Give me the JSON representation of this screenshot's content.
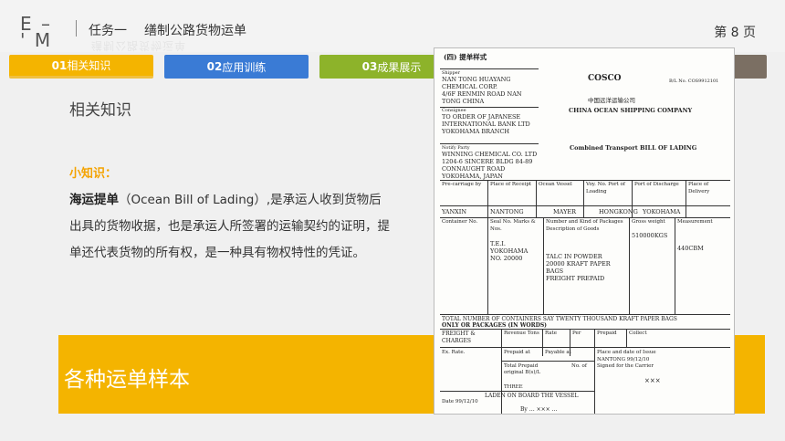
{
  "header": {
    "logo": "E – ' M",
    "task_label": "任务一",
    "task_title": "缮制公路货物运单",
    "task_shadow": "缮制公路货物运单",
    "page": "第 8 页"
  },
  "tabs": [
    {
      "num": "01",
      "label": "相关知识"
    },
    {
      "num": "02",
      "label": "应用训练"
    },
    {
      "num": "03",
      "label": "成果展示"
    }
  ],
  "content": {
    "section_title": "相关知识",
    "tip_label": "小知识：",
    "term": "海运提单",
    "body": "（Ocean Bill of Lading）,是承运人收到货物后出具的货物收据，也是承运人所签署的运输契约的证明，提单还代表货物的所有权，是一种具有物权特性的凭证。"
  },
  "banner": {
    "title": "各种运单样本"
  },
  "document": {
    "heading": "(四) 提单样式",
    "shipper_label": "Shipper",
    "shipper": [
      "NAN      TONG       HUAYANG",
      "CHEMICAL CORP.",
      "4/6F   RENMIN   ROAD   NAN",
      "TONG CHINA"
    ],
    "consignee_label": "Consignee",
    "consignee": [
      "TO   ORDER   OF   JAPANESE",
      "INTERNATIONAL   BANK   LTD",
      "YOKOHAMA BRANCH"
    ],
    "notify_label": "Notify Party",
    "notify": [
      "WINNING CHEMICAL CO.  LTD",
      "1204-6 SINCERE BLDG 84-89",
      "CONNAUGHT ROAD",
      "YOKOHAMA, JAPAN"
    ],
    "cosco": "COSCO",
    "bl_no": "B/L No. COS9912101",
    "company_cn": "中国远洋运输公司",
    "company_en": "CHINA OCEAN SHIPPING COMPANY",
    "combined": "Combined Transport BILL OF LADING",
    "row_headers": [
      "Pre-carriage by",
      "Place of Receipt",
      "Ocean Vessel",
      "Voy. No. Port of Loading",
      "Port of Discharge",
      "Place of Delivery"
    ],
    "row_values": [
      "YANXIN",
      "NANTONG",
      "MAYER",
      "HONGKONG",
      "YOKOHAMA"
    ],
    "container_label": "Container No.",
    "seal_label": "Seal No. Marks & Nos.",
    "number_kind": "Number and Kind of Packages Description of Goods",
    "gross_label": "Gross weight",
    "measure_label": "Measurement",
    "marks": [
      "T.E.I.",
      "YOKOHAMA",
      "NO. 20000"
    ],
    "goods": [
      "TALC IN POWDER",
      "20000   KRAFT   PAPER",
      "BAGS",
      "FREIGHT PREPAID"
    ],
    "gross": "510000KGS",
    "measure": "440CBM",
    "total_line1": "TOTAL NUMBER OF CONTAINERS SAY TWENTY THOUSAND KRAFT PAPER BAGS",
    "total_line2": "ONLY OR PACKAGES (IN WORDS)",
    "freight_label": "FREIGHT & CHARGES",
    "revenue": "Revenue Tons",
    "rate": "Rate",
    "per": "Per",
    "prepaid": "Prepaid",
    "collect": "Collect",
    "ex_rate": "Ex. Rate.",
    "prepaid_at": "Prepaid at",
    "payable_at": "Payable at",
    "place_date": "Place and date of Issue",
    "issue": "NANTONG 99/12/10",
    "total_prepaid": "Total  Prepaid",
    "no_of": "No.  of",
    "original": "original B(s)/L",
    "signed": "Signed for the Carrier",
    "sign_marks": "×××",
    "three": "THREE",
    "laden": "LADEN ON BOARD THE VESSEL",
    "date": "Date 99/12/10",
    "by": "By  …  ×××  …"
  }
}
